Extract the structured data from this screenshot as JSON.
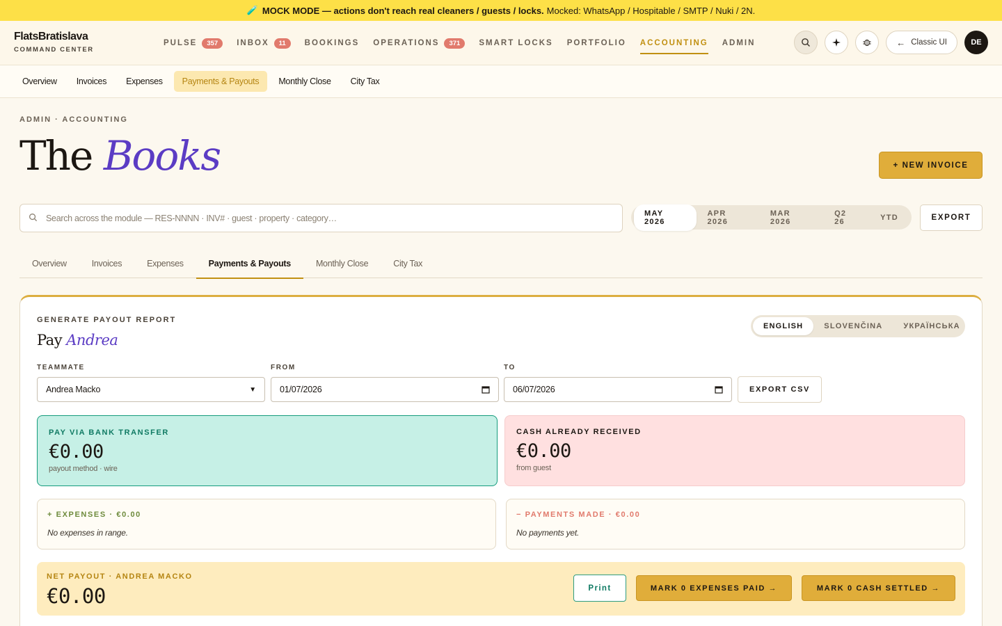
{
  "banner": {
    "icon": "🧪",
    "strong": "MOCK MODE — actions don't reach real cleaners / guests / locks.",
    "rest": "Mocked: WhatsApp / Hospitable / SMTP / Nuki / 2N."
  },
  "brand": {
    "name": "FlatsBratislava",
    "sub": "COMMAND CENTER"
  },
  "nav": [
    {
      "label": "PULSE",
      "badge": "357"
    },
    {
      "label": "INBOX",
      "badge": "11"
    },
    {
      "label": "BOOKINGS",
      "badge": ""
    },
    {
      "label": "OPERATIONS",
      "badge": "371"
    },
    {
      "label": "SMART LOCKS",
      "badge": ""
    },
    {
      "label": "PORTFOLIO",
      "badge": ""
    },
    {
      "label": "ACCOUNTING",
      "badge": ""
    },
    {
      "label": "ADMIN",
      "badge": ""
    }
  ],
  "tools": {
    "classic_label": "Classic UI",
    "avatar": "DE"
  },
  "subnav": [
    "Overview",
    "Invoices",
    "Expenses",
    "Payments & Payouts",
    "Monthly Close",
    "City Tax"
  ],
  "page": {
    "crumb": "ADMIN · ACCOUNTING",
    "title_plain": "The",
    "title_italic": "Books",
    "new_invoice": "+ NEW INVOICE"
  },
  "search": {
    "placeholder": "Search across the module — RES-NNNN · INV# · guest · property · category…"
  },
  "periods": [
    "MAY 2026",
    "APR 2026",
    "MAR 2026",
    "Q2 26",
    "YTD"
  ],
  "export_label": "EXPORT",
  "tabs": [
    "Overview",
    "Invoices",
    "Expenses",
    "Payments & Payouts",
    "Monthly Close",
    "City Tax"
  ],
  "report": {
    "label": "GENERATE PAYOUT REPORT",
    "title_plain": "Pay",
    "title_italic": "Andrea",
    "languages": [
      "ENGLISH",
      "SLOVENČINA",
      "УКРАЇНСЬКА"
    ],
    "teammate_label": "TEAMMATE",
    "teammate_value": "Andrea Macko",
    "from_label": "FROM",
    "from_value": "01/07/2026",
    "to_label": "TO",
    "to_value": "06/07/2026",
    "export_csv": "EXPORT CSV",
    "bank": {
      "label": "PAY VIA BANK TRANSFER",
      "amount": "€0.00",
      "sub": "payout method · wire"
    },
    "cash": {
      "label": "CASH ALREADY RECEIVED",
      "amount": "€0.00",
      "sub": "from guest"
    },
    "expenses": {
      "label": "+ EXPENSES · €0.00",
      "empty": "No expenses in range."
    },
    "payments": {
      "label": "− PAYMENTS MADE · €0.00",
      "empty": "No payments yet."
    },
    "net": {
      "label": "NET PAYOUT · ANDREA MACKO",
      "amount": "€0.00",
      "print": "Print",
      "mark_expenses": "MARK 0 EXPENSES PAID →",
      "mark_cash": "MARK 0 CASH SETTLED →"
    }
  },
  "colors": {
    "accent": "#c19012",
    "purple": "#5b3cc4",
    "teal": "#149b7c",
    "banner": "#fde047"
  }
}
